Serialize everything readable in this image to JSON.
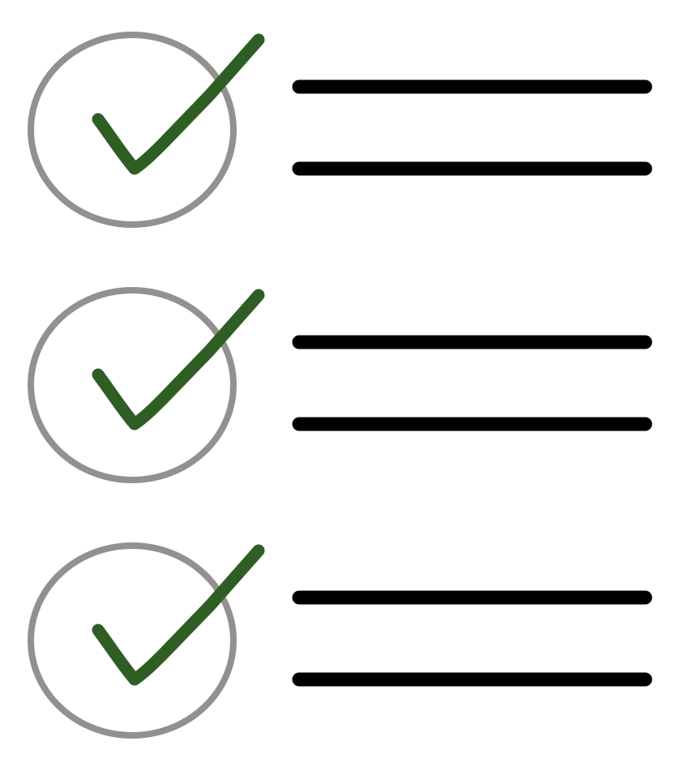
{
  "checklist": {
    "colors": {
      "circle": "#959090",
      "check": "#2f5e24",
      "line": "#000000",
      "background": "#ffffff"
    },
    "items": [
      {
        "checked": true,
        "icon": "checkmark-icon"
      },
      {
        "checked": true,
        "icon": "checkmark-icon"
      },
      {
        "checked": true,
        "icon": "checkmark-icon"
      }
    ]
  }
}
